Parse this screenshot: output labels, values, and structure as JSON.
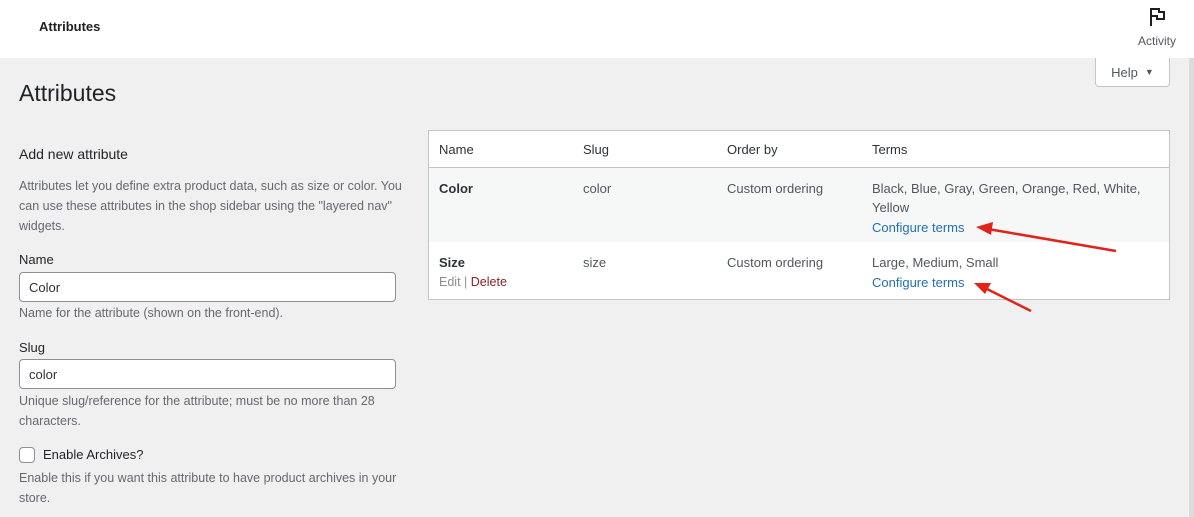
{
  "header": {
    "title": "Attributes",
    "activity_label": "Activity",
    "activity_icon": "flag-icon"
  },
  "help": {
    "label": "Help",
    "caret": "▼"
  },
  "page": {
    "title": "Attributes"
  },
  "form": {
    "heading": "Add new attribute",
    "intro": "Attributes let you define extra product data, such as size or color. You can use these attributes in the shop sidebar using the \"layered nav\" widgets.",
    "name_label": "Name",
    "name_value": "Color",
    "name_help": "Name for the attribute (shown on the front-end).",
    "slug_label": "Slug",
    "slug_value": "color",
    "slug_help": "Unique slug/reference for the attribute; must be no more than 28 characters.",
    "archives_label": "Enable Archives?",
    "archives_checked": false,
    "archives_help": "Enable this if you want this attribute to have product archives in your store."
  },
  "table": {
    "columns": [
      "Name",
      "Slug",
      "Order by",
      "Terms"
    ],
    "rows": [
      {
        "name": "Color",
        "slug": "color",
        "order_by": "Custom ordering",
        "terms": "Black, Blue, Gray, Green, Orange, Red, White, Yellow",
        "configure": "Configure terms"
      },
      {
        "name": "Size",
        "slug": "size",
        "order_by": "Custom ordering",
        "terms": "Large, Medium, Small",
        "configure": "Configure terms",
        "edit": "Edit",
        "separator": "|",
        "delete": "Delete"
      }
    ]
  },
  "colors": {
    "link": "#2271b1",
    "delete": "#8a2424",
    "annotation_arrow": "#e2231a"
  }
}
